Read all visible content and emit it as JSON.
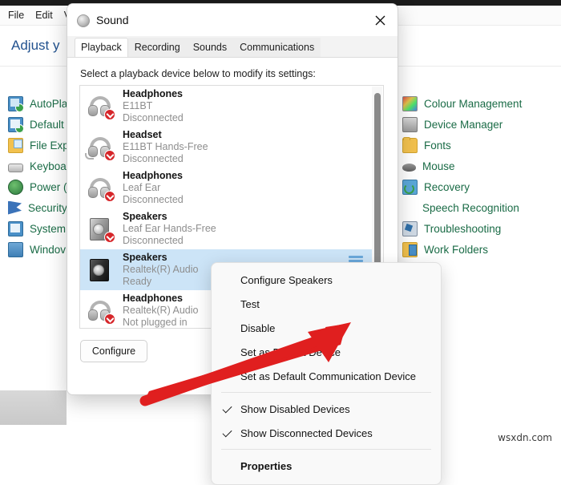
{
  "control_panel": {
    "menu": [
      "File",
      "Edit",
      "Vi"
    ],
    "heading": "Adjust y",
    "left_items": [
      {
        "label": "AutoPla",
        "icon": "autoplay-icon"
      },
      {
        "label": "Default",
        "icon": "default-programs-icon"
      },
      {
        "label": "File Exp",
        "icon": "file-explorer-icon"
      },
      {
        "label": "Keyboa",
        "icon": "keyboard-icon"
      },
      {
        "label": "Power (",
        "icon": "power-options-icon"
      },
      {
        "label": "Security",
        "icon": "security-maintenance-icon"
      },
      {
        "label": "System",
        "icon": "system-icon"
      },
      {
        "label": "Windov",
        "icon": "windows-tools-icon"
      }
    ],
    "right_items": [
      {
        "label": "Colour Management",
        "icon": "colour-management-icon"
      },
      {
        "label": "Device Manager",
        "icon": "device-manager-icon"
      },
      {
        "label": "Fonts",
        "icon": "fonts-icon"
      },
      {
        "label": "Mouse",
        "icon": "mouse-icon"
      },
      {
        "label": "Recovery",
        "icon": "recovery-icon"
      },
      {
        "label": "Speech Recognition",
        "icon": "speech-recognition-icon"
      },
      {
        "label": "Troubleshooting",
        "icon": "troubleshooting-icon"
      },
      {
        "label": "Work Folders",
        "icon": "work-folders-icon"
      }
    ],
    "partial_text": ")"
  },
  "sound_dialog": {
    "title": "Sound",
    "close_label": "✕",
    "tabs": [
      {
        "label": "Playback",
        "active": true
      },
      {
        "label": "Recording",
        "active": false
      },
      {
        "label": "Sounds",
        "active": false
      },
      {
        "label": "Communications",
        "active": false
      }
    ],
    "instruction": "Select a playback device below to modify its settings:",
    "devices": [
      {
        "name": "Headphones",
        "desc": "E11BT",
        "status": "Disconnected",
        "icon": "headphones-icon",
        "selected": false
      },
      {
        "name": "Headset",
        "desc": "E11BT Hands-Free",
        "status": "Disconnected",
        "icon": "headset-icon",
        "selected": false
      },
      {
        "name": "Headphones",
        "desc": "Leaf Ear",
        "status": "Disconnected",
        "icon": "headphones-icon",
        "selected": false
      },
      {
        "name": "Speakers",
        "desc": "Leaf Ear Hands-Free",
        "status": "Disconnected",
        "icon": "speakers-icon",
        "selected": false
      },
      {
        "name": "Speakers",
        "desc": "Realtek(R) Audio",
        "status": "Ready",
        "icon": "speakers-icon",
        "selected": true
      },
      {
        "name": "Headphones",
        "desc": "Realtek(R) Audio",
        "status": "Not plugged in",
        "icon": "headphones-icon",
        "selected": false
      }
    ],
    "configure_label": "Configure"
  },
  "context_menu": {
    "items": [
      {
        "label": "Configure Speakers",
        "checked": false,
        "bold": false
      },
      {
        "label": "Test",
        "checked": false,
        "bold": false
      },
      {
        "label": "Disable",
        "checked": false,
        "bold": false
      },
      {
        "label": "Set as Default Device",
        "checked": false,
        "bold": false
      },
      {
        "label": "Set as Default Communication Device",
        "checked": false,
        "bold": false
      },
      {
        "separator": true
      },
      {
        "label": "Show Disabled Devices",
        "checked": true,
        "bold": false
      },
      {
        "label": "Show Disconnected Devices",
        "checked": true,
        "bold": false
      },
      {
        "separator": true
      },
      {
        "label": "Properties",
        "checked": false,
        "bold": true
      }
    ]
  },
  "annotation": {
    "arrow_color": "#e01f1f",
    "points_to": "Set as Default Device"
  },
  "watermark": "wsxdn.com"
}
